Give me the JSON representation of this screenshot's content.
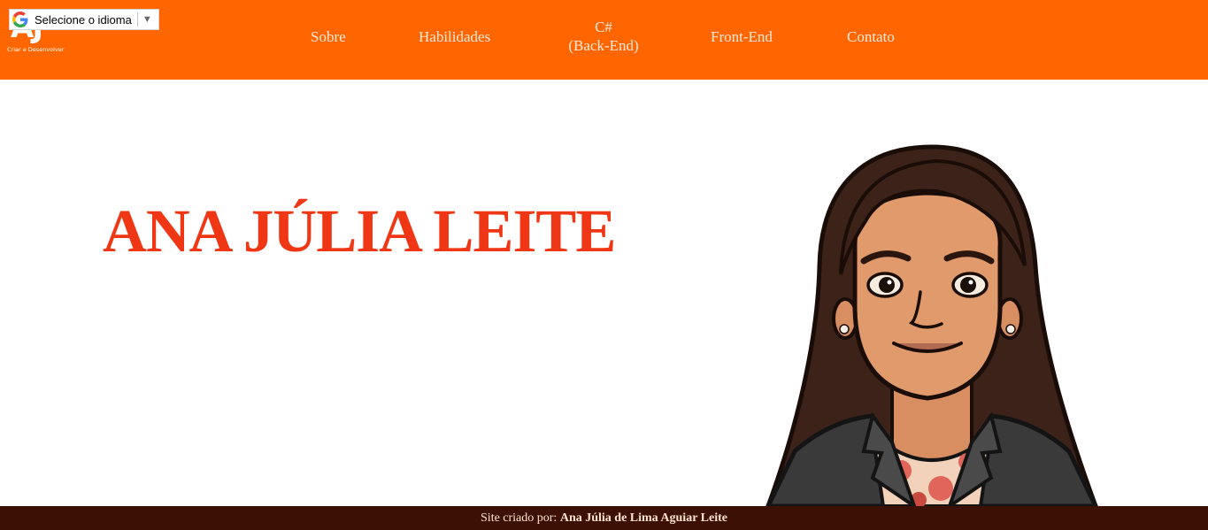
{
  "brand": {
    "logo_text": "AJ",
    "tagline": "Criar e Desenvolver"
  },
  "translate_widget": {
    "label": "Selecione o idioma",
    "icon": "google-g-icon",
    "arrow": "▼"
  },
  "nav": {
    "items": [
      {
        "label": "Sobre"
      },
      {
        "label": "Habilidades"
      },
      {
        "label": "C#",
        "label2": "(Back-End)"
      },
      {
        "label": "Front-End"
      },
      {
        "label": "Contato"
      }
    ]
  },
  "hero": {
    "title": "ANA JÚLIA LEITE",
    "image": "avatar-illustration"
  },
  "footer": {
    "prefix": "Site criado por:",
    "author": "Ana Júlia de Lima Aguiar Leite"
  },
  "colors": {
    "header_bg": "#ff6600",
    "title": "#ef3715",
    "footer_bg": "#3c1103",
    "nav_text": "#ffe9da"
  }
}
